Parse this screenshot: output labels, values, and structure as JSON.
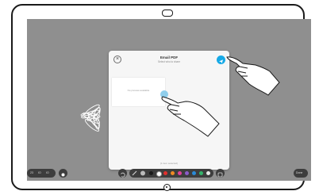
{
  "modal": {
    "close_glyph": "×",
    "title": "Email PDF",
    "subtitle": "Select who to share",
    "preview_text": "No preview available",
    "footer": "(1 item selected)"
  },
  "toolbar": {
    "left_labels": [
      "23",
      "IO",
      "IO"
    ],
    "right_label": "Done",
    "colors": [
      "#1a1a1a",
      "#ffffff",
      "#e0302e",
      "#f08a24",
      "#e23f9a",
      "#8a5cc9",
      "#2a8bd8",
      "#34b36b",
      "#e9e9e9"
    ]
  },
  "accent": "#16a9e6",
  "icons": [
    "close-icon",
    "send-icon",
    "undo-icon",
    "pen-icon",
    "eraser-icon",
    "grid-icon",
    "hand-pointer-icon",
    "flower-drawing"
  ]
}
